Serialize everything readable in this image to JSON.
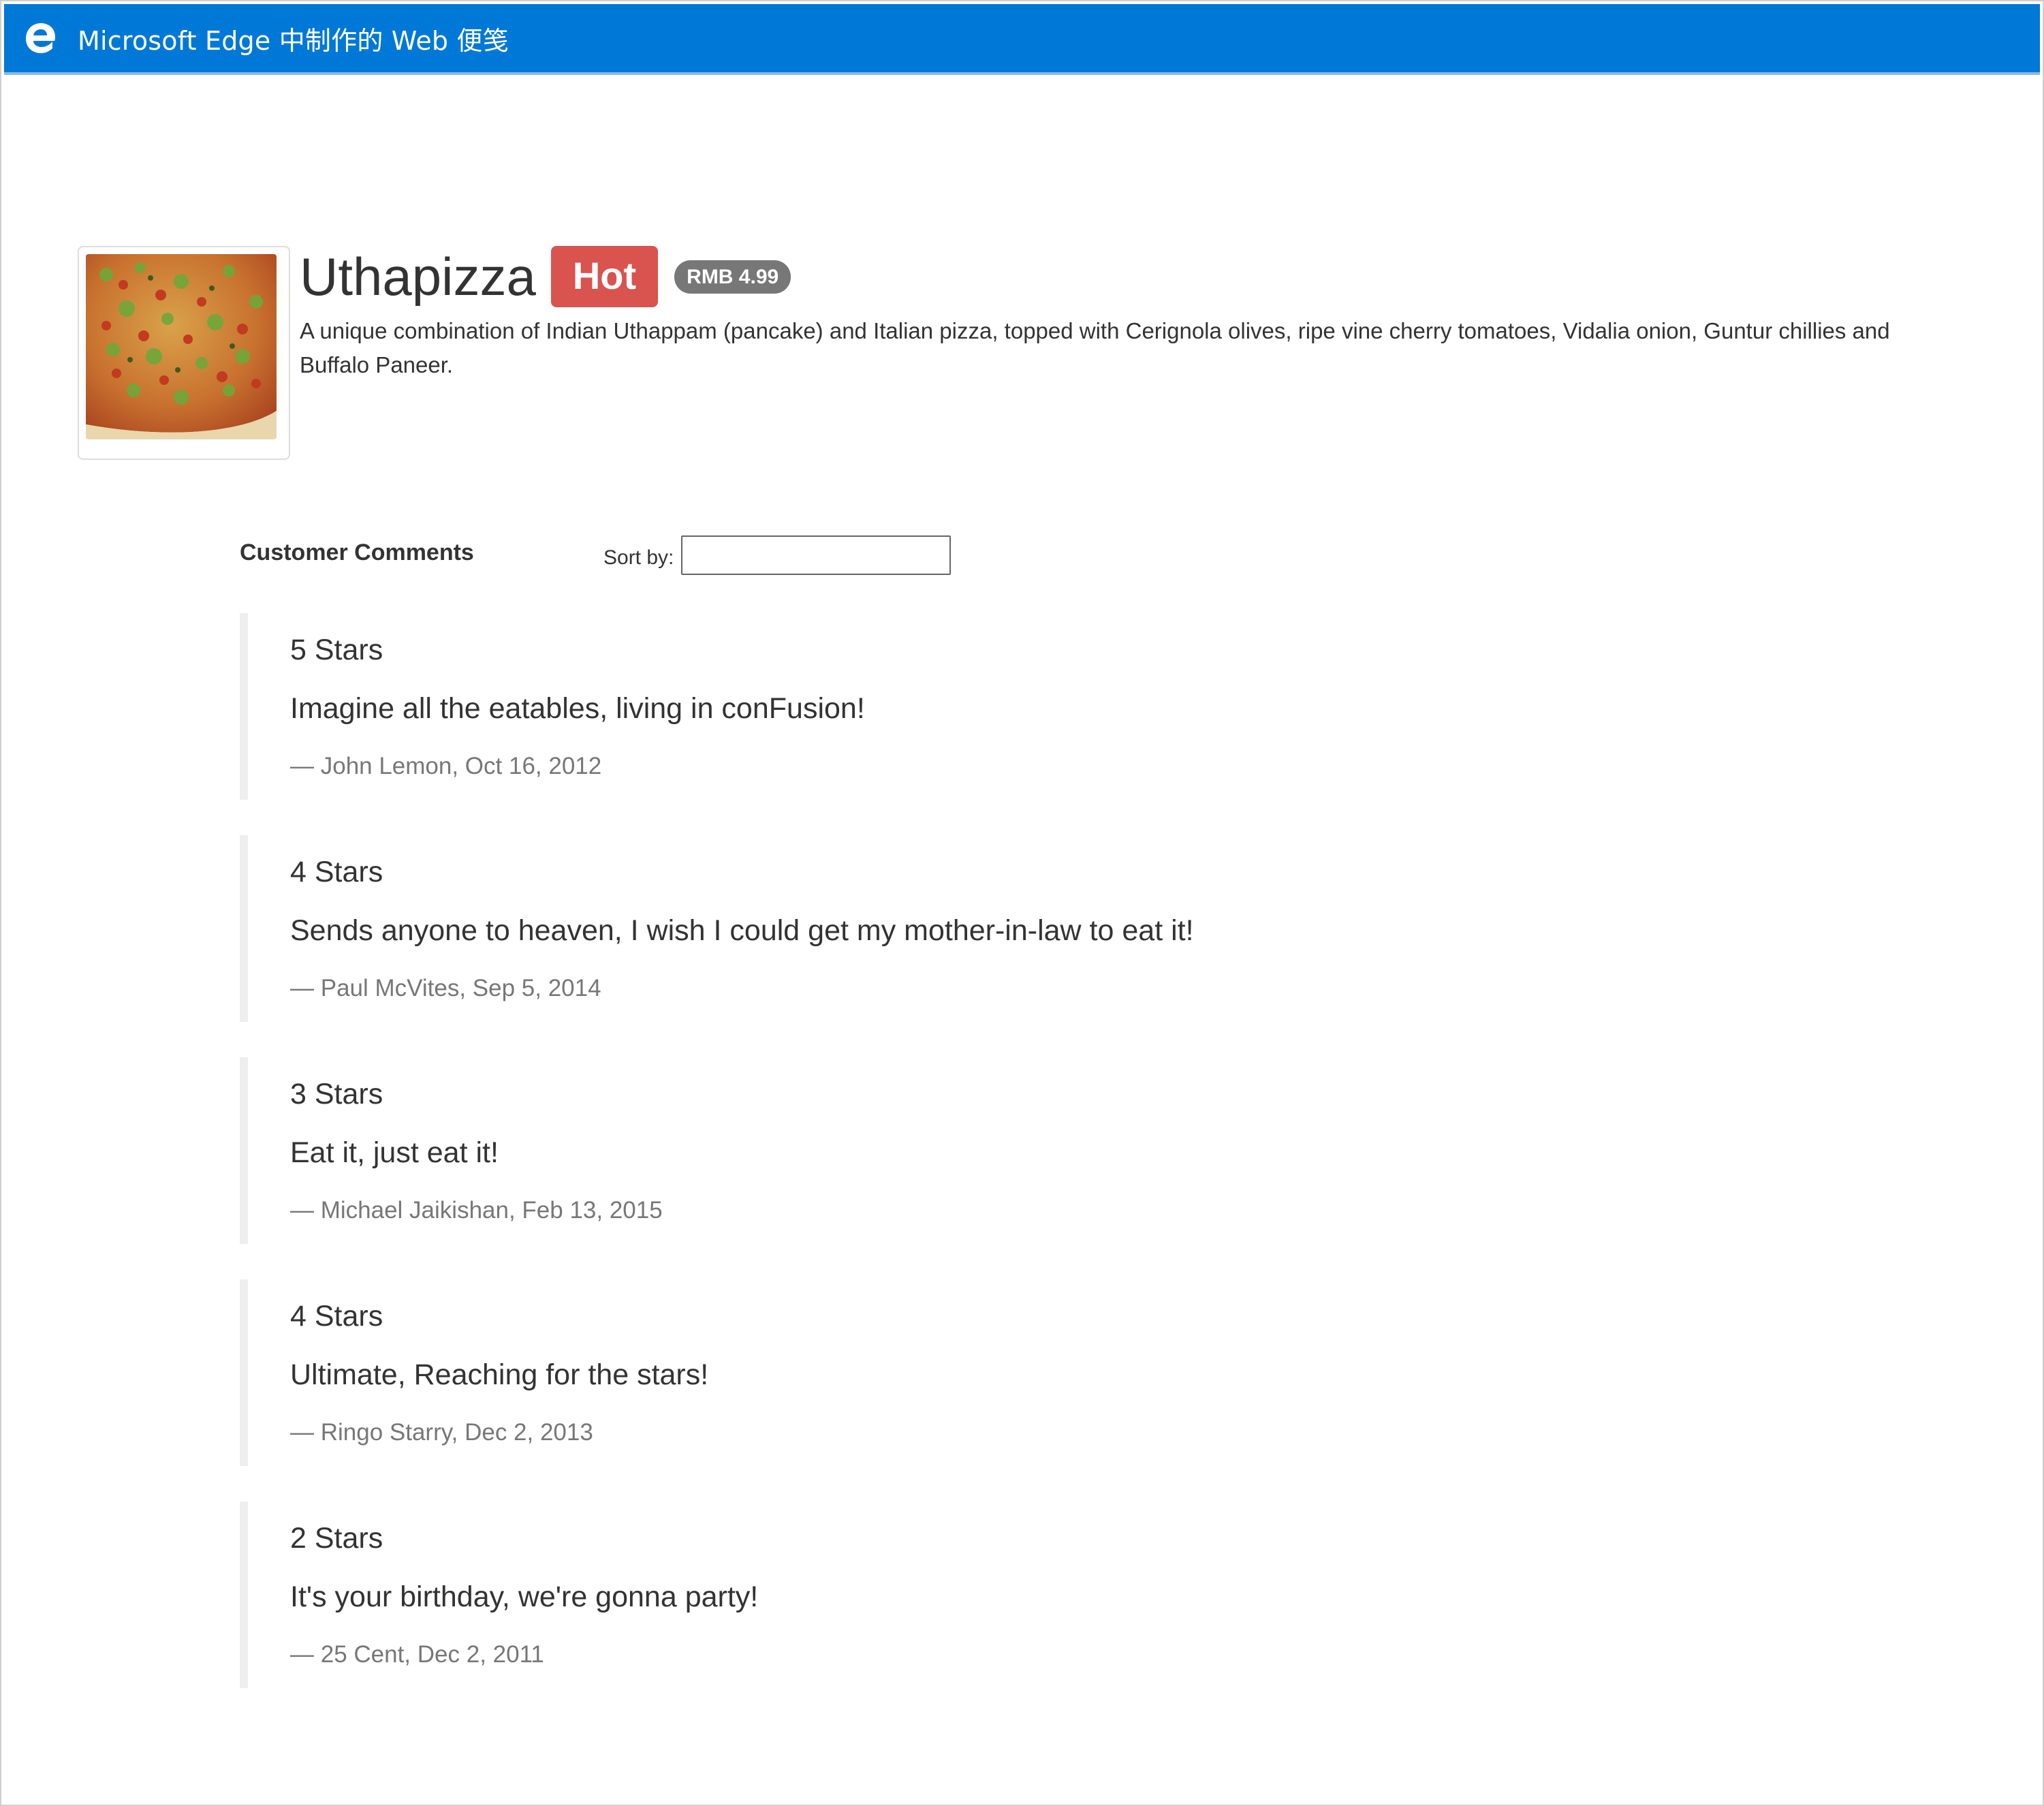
{
  "window": {
    "title": "Microsoft Edge 中制作的 Web 便笺",
    "logo_icon": "edge-logo-icon",
    "titlebar_color": "#0078d7"
  },
  "dish": {
    "image_alt": "pizza-image",
    "name": "Uthapizza",
    "label": "Hot",
    "label_color": "#d9534f",
    "price": "RMB 4.99",
    "description": "A unique combination of Indian Uthappam (pancake) and Italian pizza, topped with Cerignola olives, ripe vine cherry tomatoes, Vidalia onion, Guntur chillies and Buffalo Paneer."
  },
  "comments": {
    "title": "Customer Comments",
    "sort_label": "Sort by:",
    "sort_value": "",
    "items": [
      {
        "stars": "5 Stars",
        "text": "Imagine all the eatables, living in conFusion!",
        "author": "— John Lemon, Oct 16, 2012"
      },
      {
        "stars": "4 Stars",
        "text": "Sends anyone to heaven, I wish I could get my mother-in-law to eat it!",
        "author": "— Paul McVites, Sep 5, 2014"
      },
      {
        "stars": "3 Stars",
        "text": "Eat it, just eat it!",
        "author": "— Michael Jaikishan, Feb 13, 2015"
      },
      {
        "stars": "4 Stars",
        "text": "Ultimate, Reaching for the stars!",
        "author": "— Ringo Starry, Dec 2, 2013"
      },
      {
        "stars": "2 Stars",
        "text": "It's your birthday, we're gonna party!",
        "author": "— 25 Cent, Dec 2, 2011"
      }
    ]
  }
}
